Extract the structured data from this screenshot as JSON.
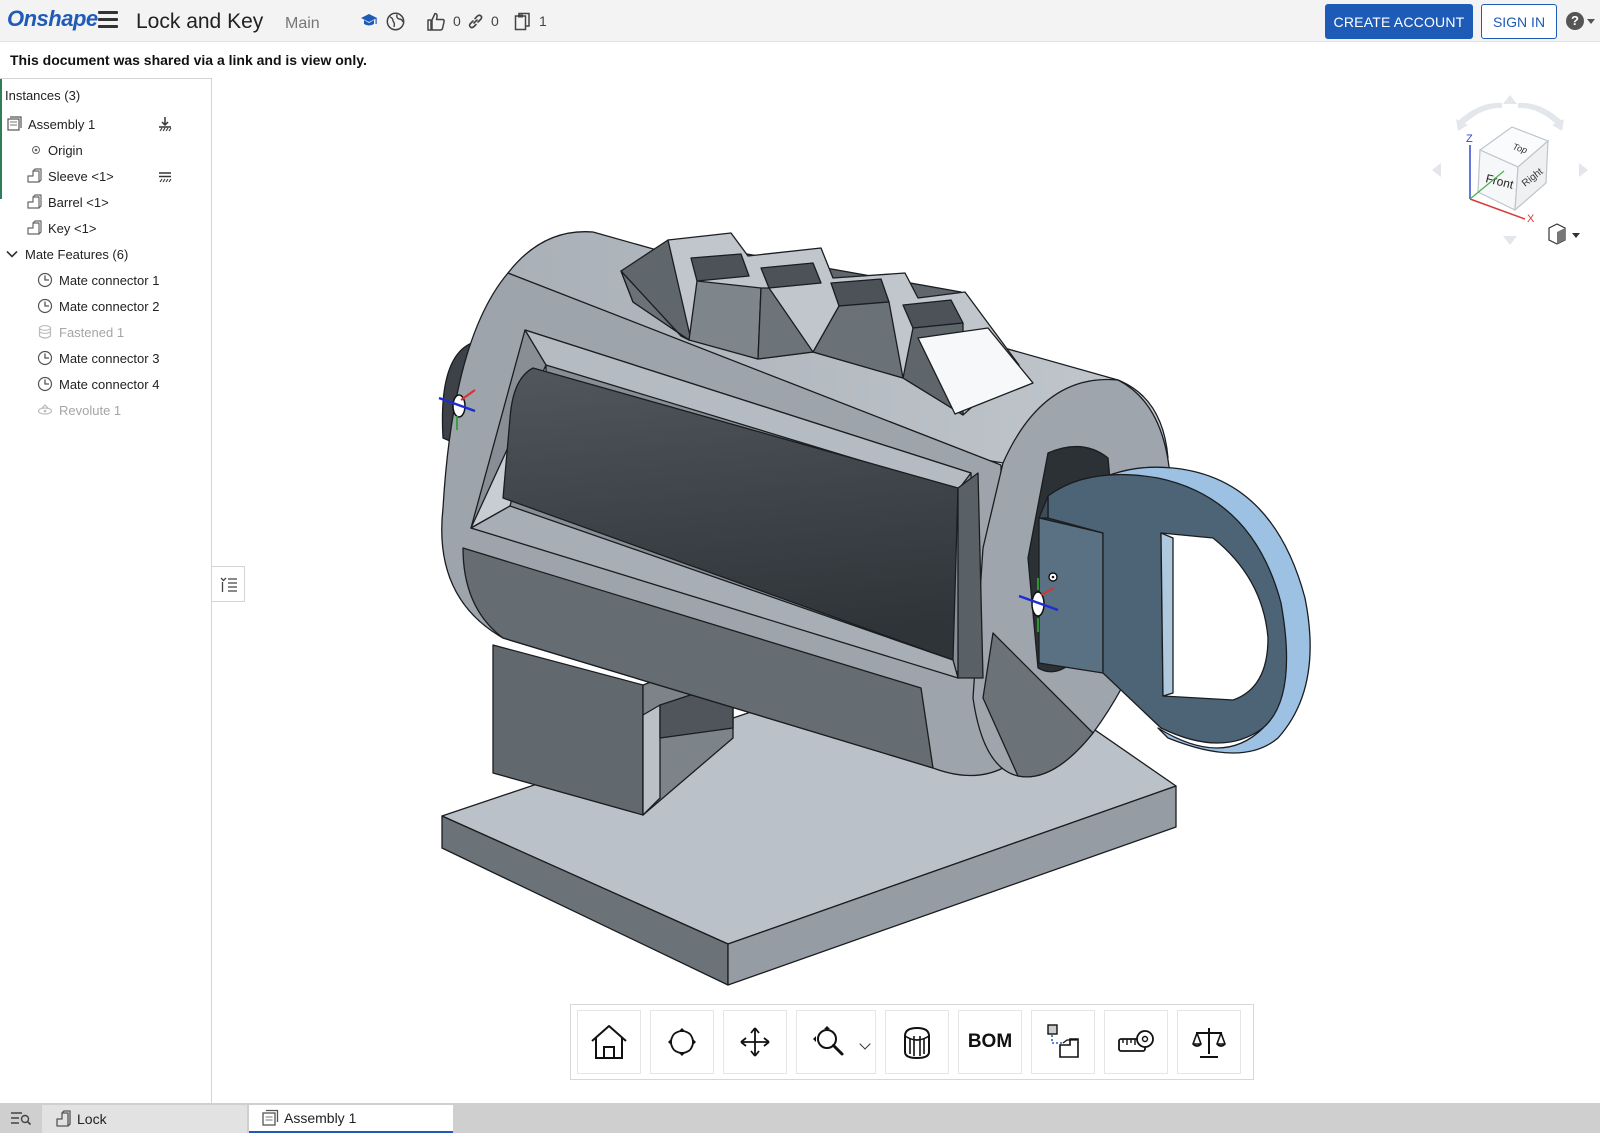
{
  "header": {
    "logo": "Onshape",
    "menu_icon": "hamburger-icon",
    "doc_title": "Lock and Key",
    "branch": "Main",
    "likes": "0",
    "links": "0",
    "copies": "1",
    "create_account": "CREATE ACCOUNT",
    "sign_in": "SIGN IN",
    "help_icon": "?"
  },
  "banner": "This document was shared via a link and is view only.",
  "instances": {
    "title": "Instances (3)",
    "items": [
      {
        "label": "Assembly 1",
        "icon": "assembly-icon"
      },
      {
        "label": "Origin",
        "icon": "origin-icon"
      },
      {
        "label": "Sleeve <1>",
        "icon": "part-instance-icon"
      },
      {
        "label": "Barrel <1>",
        "icon": "part-instance-icon"
      },
      {
        "label": "Key <1>",
        "icon": "part-instance-icon"
      }
    ],
    "mate_features": {
      "label": "Mate Features (6)",
      "items": [
        {
          "label": "Mate connector 1",
          "icon": "mate-connector-icon"
        },
        {
          "label": "Mate connector 2",
          "icon": "mate-connector-icon"
        },
        {
          "label": "Fastened 1",
          "icon": "fastened-mate-icon",
          "suppressed": true
        },
        {
          "label": "Mate connector 3",
          "icon": "mate-connector-icon"
        },
        {
          "label": "Mate connector 4",
          "icon": "mate-connector-icon"
        },
        {
          "label": "Revolute 1",
          "icon": "revolute-mate-icon",
          "suppressed": true
        }
      ]
    }
  },
  "viewcube": {
    "front": "Front",
    "top": "Top",
    "right": "Right",
    "x": "X",
    "z": "Z"
  },
  "toolbar": {
    "tools": [
      "home-view-icon",
      "rotate-icon",
      "pan-icon",
      "zoom-icon",
      "section-view-icon",
      "BOM",
      "exploded-view-icon",
      "measure-icon",
      "mass-properties-icon"
    ],
    "bom_label": "BOM"
  },
  "tabs": [
    {
      "label": "Lock",
      "icon": "part-studio-icon",
      "active": false
    },
    {
      "label": "Assembly 1",
      "icon": "assembly-icon",
      "active": true
    }
  ],
  "colors": {
    "brand": "#1e5bb7",
    "part_light": "#b8bec5",
    "part_mid": "#8f969d",
    "part_dark": "#61676d",
    "key_face": "#4d6477",
    "key_edge": "#9cc1e2"
  }
}
